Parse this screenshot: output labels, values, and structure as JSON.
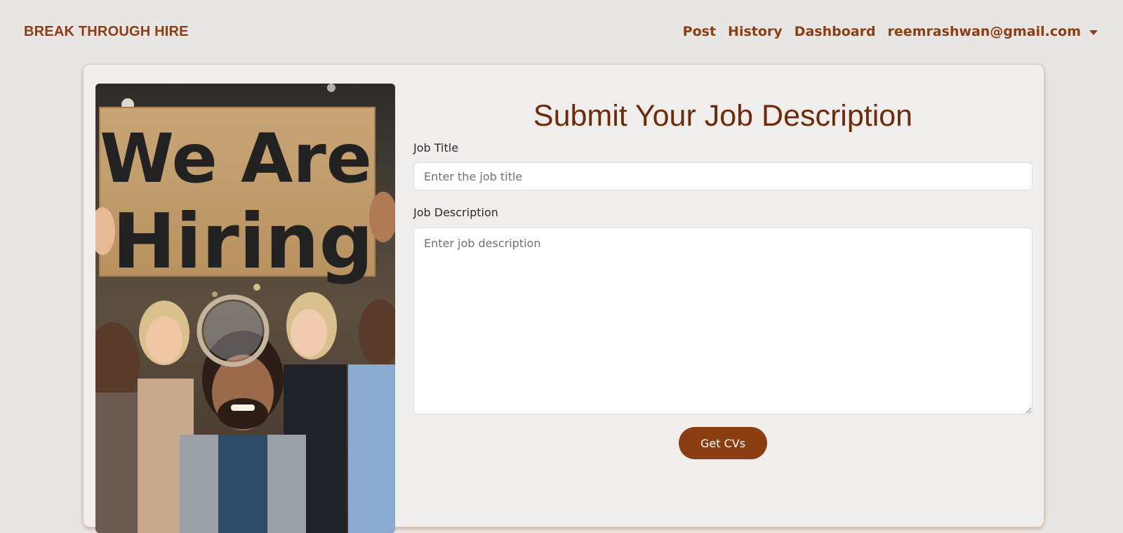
{
  "header": {
    "brand": "BREAK THROUGH HIRE",
    "nav": {
      "post": "Post",
      "history": "History",
      "dashboard": "Dashboard",
      "user_email": "reemrashwan@gmail.com"
    }
  },
  "hero": {
    "sign_line_1": "We Are",
    "sign_line_2": "Hiring"
  },
  "form": {
    "title": "Submit Your Job Description",
    "job_title_label": "Job Title",
    "job_title_placeholder": "Enter the job title",
    "job_title_value": "",
    "job_description_label": "Job Description",
    "job_description_placeholder": "Enter job description",
    "job_description_value": "",
    "submit_label": "Get CVs"
  },
  "colors": {
    "accent": "#8b3e12",
    "title": "#6b2c0c",
    "background": "#e8e6e4",
    "card": "#f0eeec"
  },
  "icons": {
    "user_menu_toggle": "caret-down-icon"
  }
}
